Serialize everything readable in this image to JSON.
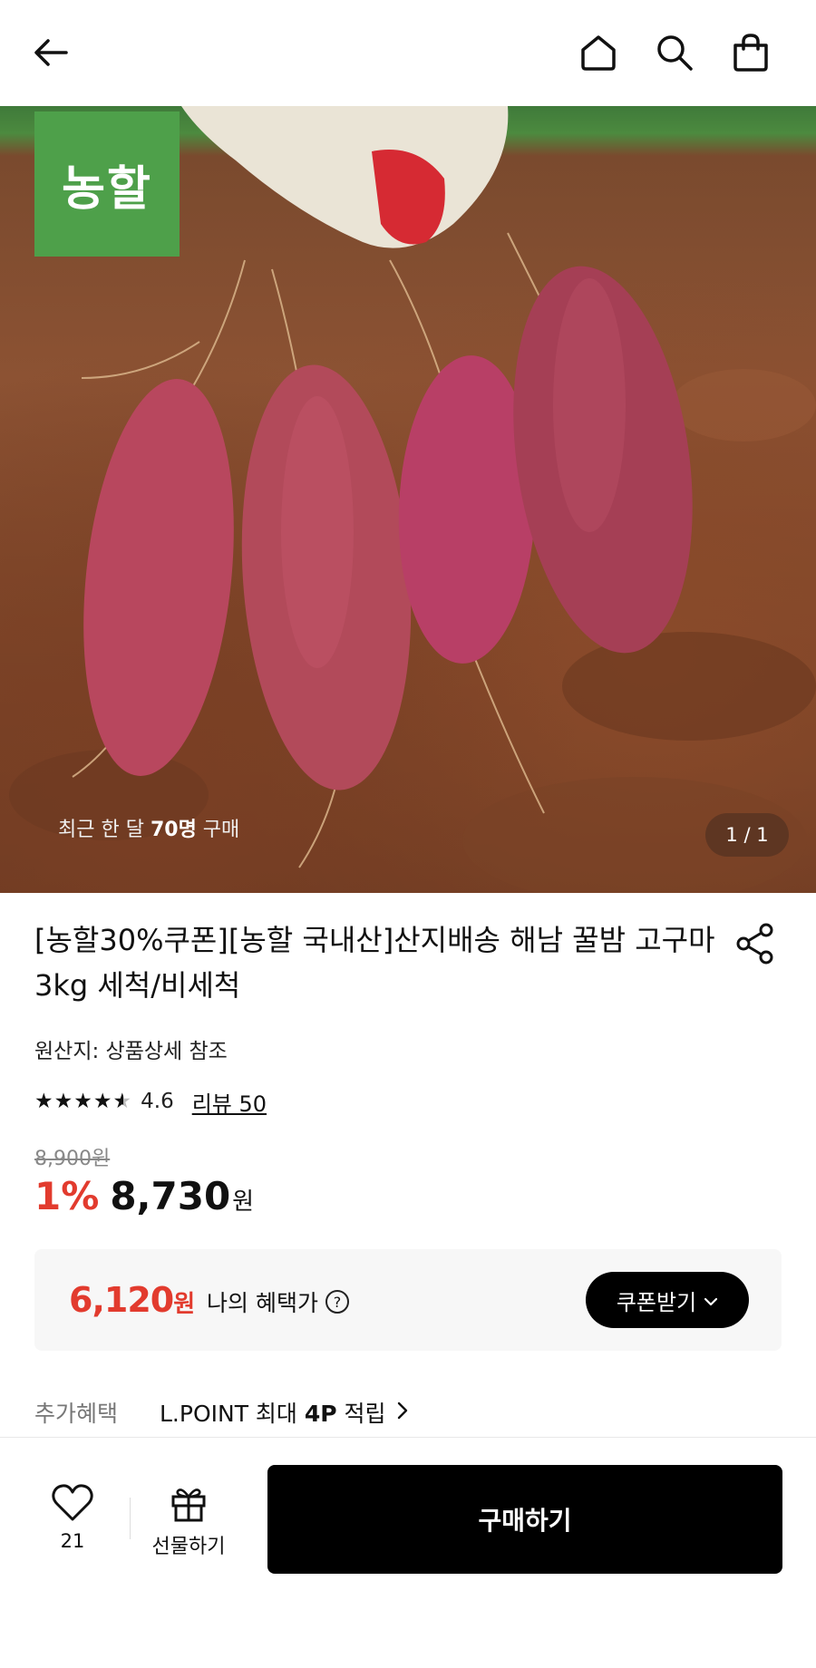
{
  "header": {
    "back_icon": "back-arrow-icon",
    "home_icon": "home-icon",
    "search_icon": "search-icon",
    "cart_icon": "shopping-bag-icon"
  },
  "hero": {
    "brand_badge": "농할",
    "recent_prefix": "최근 한 달 ",
    "recent_count": "70명",
    "recent_suffix": " 구매",
    "counter": "1 / 1"
  },
  "product": {
    "title": "[농할30%쿠폰][농할 국내산]산지배송 해남 꿀밤 고구마 3kg 세척/비세척",
    "origin": "원산지: 상품상세 참조",
    "rating": "4.6",
    "rating_value": 4.6,
    "review_link": "리뷰 50",
    "original_price": "8,900원",
    "discount": "1%",
    "price": "8,730",
    "price_unit": "원"
  },
  "benefit": {
    "price": "6,120",
    "price_unit": "원",
    "label": "나의 혜택가",
    "help": "?",
    "coupon_button": "쿠폰받기"
  },
  "extra": {
    "label": "추가혜택",
    "text_prefix": "L.POINT 최대 ",
    "text_bold": "4P",
    "text_suffix": " 적립"
  },
  "bottom": {
    "like_count": "21",
    "gift_label": "선물하기",
    "buy_label": "구매하기"
  },
  "colors": {
    "accent_red": "#e23b2e",
    "brand_green": "#4ea04a",
    "button_black": "#000000"
  }
}
